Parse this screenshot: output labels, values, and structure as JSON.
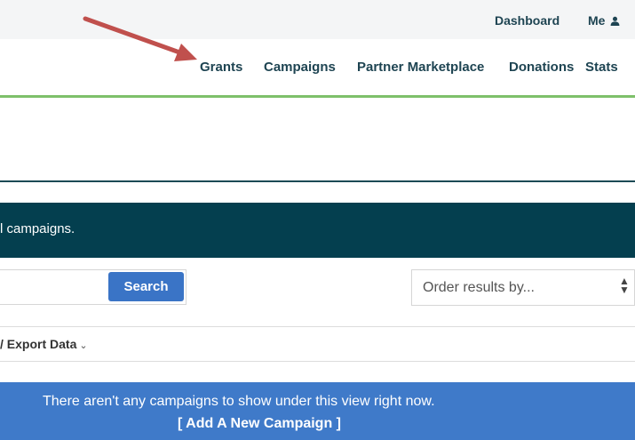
{
  "topbar": {
    "dashboard": "Dashboard",
    "me": "Me"
  },
  "nav": {
    "grants": "Grants",
    "campaigns": "Campaigns",
    "partner_marketplace": "Partner Marketplace",
    "donations": "Donations",
    "stats": "Stats"
  },
  "banner": {
    "text": "l campaigns."
  },
  "search": {
    "button_label": "Search",
    "input_value": ""
  },
  "order": {
    "placeholder": "Order results by..."
  },
  "export": {
    "label": "/ Export Data"
  },
  "empty_state": {
    "message": "There aren't any campaigns to show under this view right now.",
    "add_link": "[ Add A New Campaign ]"
  },
  "colors": {
    "annotation_arrow": "#c0504d",
    "banner_bg": "#043f4f",
    "accent_green": "#7ec06a",
    "button_blue": "#3a74c6"
  }
}
